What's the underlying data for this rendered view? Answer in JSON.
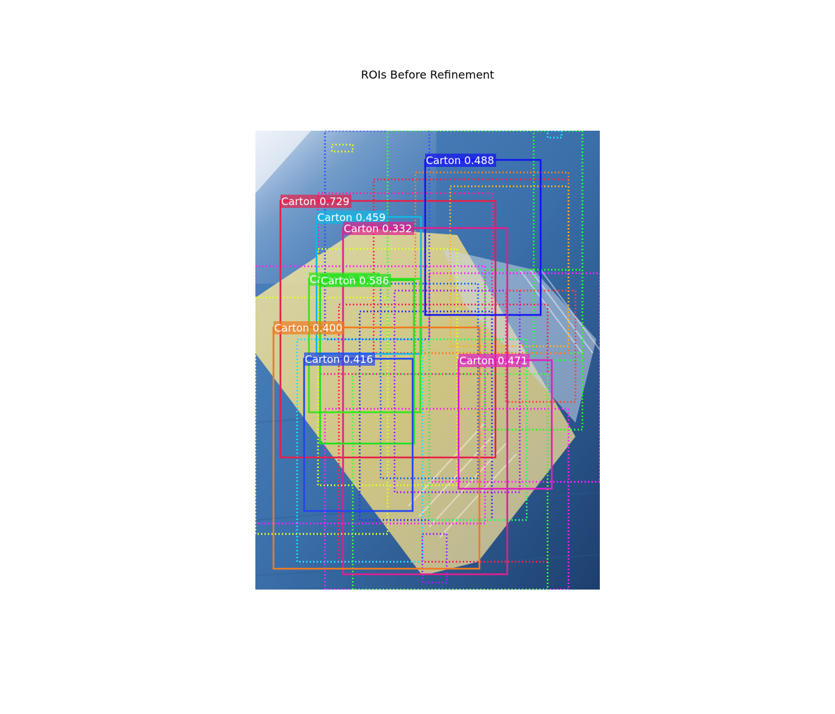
{
  "figure": {
    "title": "ROIs Before Refinement"
  },
  "image": {
    "description_icon": "photo-of-carton-on-blue-surface"
  },
  "detections": [
    {
      "label": "Carton 0.729",
      "color": "#e8204a"
    },
    {
      "label": "Carton 0.488",
      "color": "#1414f0"
    },
    {
      "label": "Carton 0.459",
      "color": "#12b8e6"
    },
    {
      "label": "Carton 0.332",
      "color": "#e0208c"
    },
    {
      "label": "Carton 0.542",
      "color": "#34e61a"
    },
    {
      "label": "Carton 0.586",
      "color": "#20e020"
    },
    {
      "label": "Carton 0.400",
      "color": "#f07a20"
    },
    {
      "label": "Carton 0.416",
      "color": "#2046f0"
    },
    {
      "label": "Carton 0.471",
      "color": "#e020c0"
    }
  ]
}
